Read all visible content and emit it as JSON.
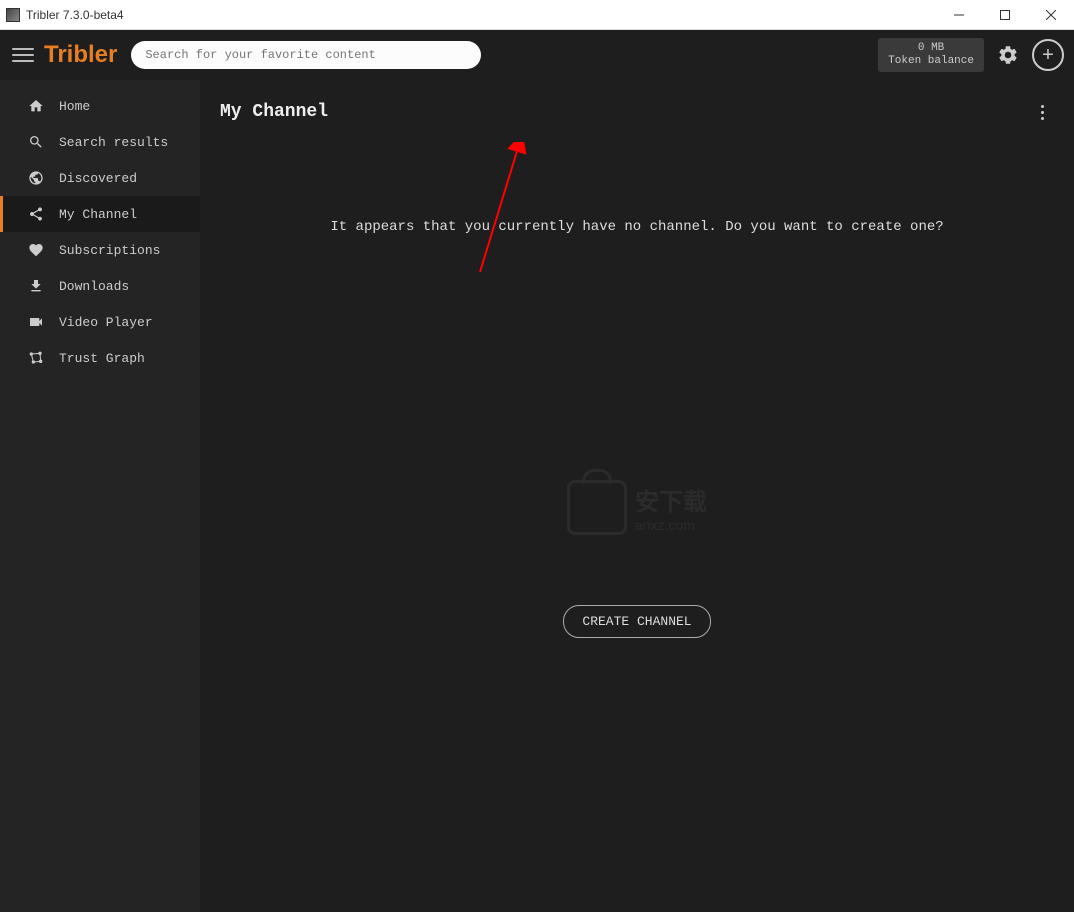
{
  "window": {
    "title": "Tribler 7.3.0-beta4"
  },
  "header": {
    "brand": "Tribler",
    "search_placeholder": "Search for your favorite content",
    "token_amount": "0 MB",
    "token_label": "Token balance"
  },
  "sidebar": {
    "items": [
      {
        "label": "Home",
        "icon": "home"
      },
      {
        "label": "Search results",
        "icon": "search"
      },
      {
        "label": "Discovered",
        "icon": "globe"
      },
      {
        "label": "My Channel",
        "icon": "share",
        "active": true
      },
      {
        "label": "Subscriptions",
        "icon": "heart"
      },
      {
        "label": "Downloads",
        "icon": "download"
      },
      {
        "label": "Video Player",
        "icon": "video"
      },
      {
        "label": "Trust Graph",
        "icon": "graph"
      }
    ]
  },
  "main": {
    "title": "My Channel",
    "empty_message": "It appears that you currently have no channel. Do you want to create one?",
    "create_button": "CREATE CHANNEL"
  },
  "watermark": {
    "cn": "安下载",
    "en": "anxz.com"
  }
}
